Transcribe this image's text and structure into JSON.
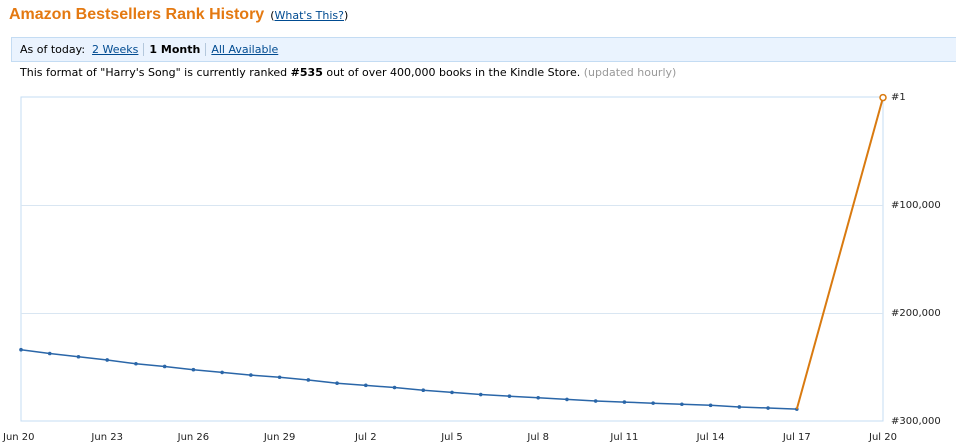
{
  "header": {
    "title": "Amazon Bestsellers Rank History",
    "paren_open": "(",
    "whats_this": "What's This?",
    "paren_close": ")"
  },
  "range_tabs": {
    "prefix": "As of today:",
    "items": [
      {
        "label": "2 Weeks",
        "active": false
      },
      {
        "label": "1 Month",
        "active": true
      },
      {
        "label": "All Available",
        "active": false
      }
    ]
  },
  "rank_info": {
    "before": "This format of \"Harry's Song\" is currently ranked ",
    "rank": "#535",
    "after": " out of over 400,000 books in the Kindle Store.",
    "note": "(updated hourly)"
  },
  "colors": {
    "grid": "#d9e6f2",
    "axis": "#c4dcf3",
    "history_line": "#2a66a8",
    "current_line": "#d97a10",
    "tick_text": "#222222"
  },
  "chart_data": {
    "type": "line",
    "x_tick_labels": [
      "Jun 20",
      "Jun 23",
      "Jun 26",
      "Jun 29",
      "Jul 2",
      "Jul 5",
      "Jul 8",
      "Jul 11",
      "Jul 14",
      "Jul 17",
      "Jul 20"
    ],
    "x_range_days": [
      0,
      30
    ],
    "y_tick_labels": [
      "#1",
      "#100,000",
      "#200,000",
      "#300,000"
    ],
    "y_range": [
      1,
      300000
    ],
    "y_axis_position": "right",
    "y_inverted": true,
    "grid": true,
    "series": [
      {
        "role": "history",
        "x_days": [
          0,
          1,
          2,
          3,
          4,
          5,
          6,
          7,
          8,
          9,
          10,
          11,
          12,
          13,
          14,
          15,
          16,
          17,
          18,
          19,
          20,
          21,
          22,
          23,
          24,
          25,
          26,
          27
        ],
        "values": [
          234000,
          237500,
          240500,
          243500,
          247000,
          249500,
          252500,
          255000,
          257500,
          259500,
          262000,
          265000,
          267000,
          269000,
          271500,
          273500,
          275500,
          277000,
          278500,
          280000,
          281500,
          282500,
          283500,
          284500,
          285500,
          287000,
          288000,
          289000
        ]
      },
      {
        "role": "current",
        "x_days": [
          27,
          30
        ],
        "values": [
          289000,
          535
        ]
      }
    ]
  }
}
